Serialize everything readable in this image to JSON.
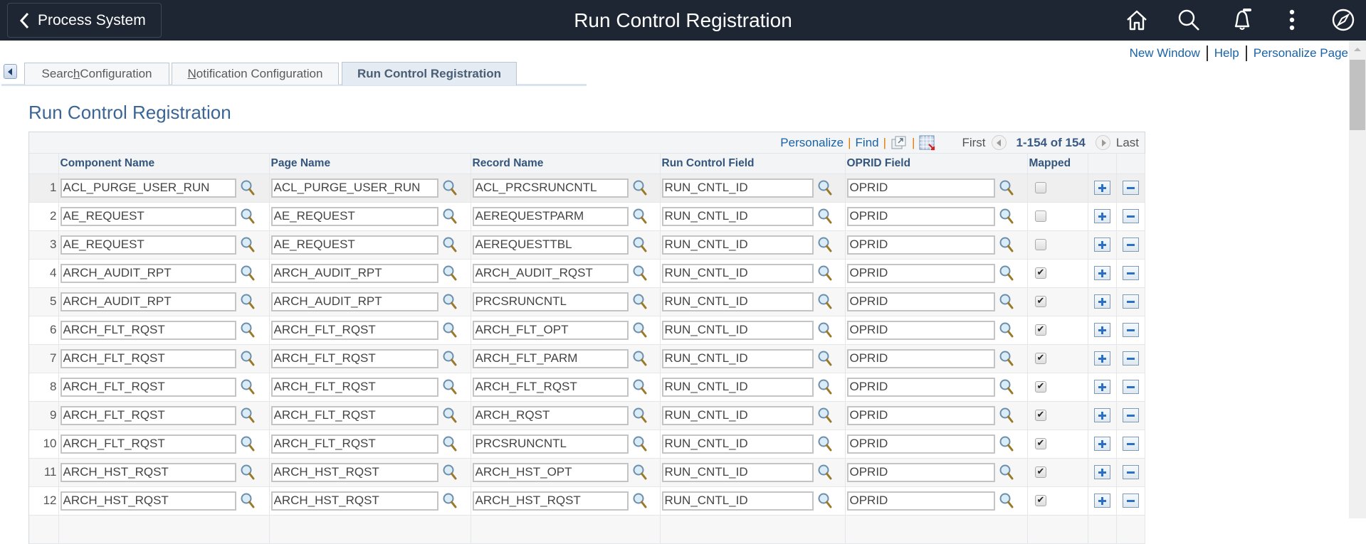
{
  "header": {
    "back_label": "Process System",
    "title": "Run Control Registration",
    "icons": [
      "home-icon",
      "search-icon",
      "notification-bell-icon",
      "actions-menu-icon",
      "navbar-compass-icon"
    ]
  },
  "toplinks": {
    "new_window": "New Window",
    "help": "Help",
    "personalize_page": "Personalize Page"
  },
  "tabs": [
    {
      "pre": "Searc",
      "accel": "h",
      "post": " Configuration",
      "active": false
    },
    {
      "pre": "",
      "accel": "N",
      "post": "otification Configuration",
      "active": false
    },
    {
      "pre": "Run Control Registration",
      "accel": "",
      "post": "",
      "active": true
    }
  ],
  "page_title": "Run Control Registration",
  "grid": {
    "toolbar": {
      "personalize": "Personalize",
      "find": "Find",
      "first": "First",
      "count": "1-154 of 154",
      "last": "Last"
    },
    "columns": [
      "Component Name",
      "Page Name",
      "Record Name",
      "Run Control Field",
      "OPRID Field",
      "Mapped"
    ],
    "rows": [
      {
        "n": "1",
        "component": "ACL_PURGE_USER_RUN",
        "page": "ACL_PURGE_USER_RUN",
        "record": "ACL_PRCSRUNCNTL",
        "runctl": "RUN_CNTL_ID",
        "oprid": "OPRID",
        "mapped": false
      },
      {
        "n": "2",
        "component": "AE_REQUEST",
        "page": "AE_REQUEST",
        "record": "AEREQUESTPARM",
        "runctl": "RUN_CNTL_ID",
        "oprid": "OPRID",
        "mapped": false
      },
      {
        "n": "3",
        "component": "AE_REQUEST",
        "page": "AE_REQUEST",
        "record": "AEREQUESTTBL",
        "runctl": "RUN_CNTL_ID",
        "oprid": "OPRID",
        "mapped": false
      },
      {
        "n": "4",
        "component": "ARCH_AUDIT_RPT",
        "page": "ARCH_AUDIT_RPT",
        "record": "ARCH_AUDIT_RQST",
        "runctl": "RUN_CNTL_ID",
        "oprid": "OPRID",
        "mapped": true
      },
      {
        "n": "5",
        "component": "ARCH_AUDIT_RPT",
        "page": "ARCH_AUDIT_RPT",
        "record": "PRCSRUNCNTL",
        "runctl": "RUN_CNTL_ID",
        "oprid": "OPRID",
        "mapped": true
      },
      {
        "n": "6",
        "component": "ARCH_FLT_RQST",
        "page": "ARCH_FLT_RQST",
        "record": "ARCH_FLT_OPT",
        "runctl": "RUN_CNTL_ID",
        "oprid": "OPRID",
        "mapped": true
      },
      {
        "n": "7",
        "component": "ARCH_FLT_RQST",
        "page": "ARCH_FLT_RQST",
        "record": "ARCH_FLT_PARM",
        "runctl": "RUN_CNTL_ID",
        "oprid": "OPRID",
        "mapped": true
      },
      {
        "n": "8",
        "component": "ARCH_FLT_RQST",
        "page": "ARCH_FLT_RQST",
        "record": "ARCH_FLT_RQST",
        "runctl": "RUN_CNTL_ID",
        "oprid": "OPRID",
        "mapped": true
      },
      {
        "n": "9",
        "component": "ARCH_FLT_RQST",
        "page": "ARCH_FLT_RQST",
        "record": "ARCH_RQST",
        "runctl": "RUN_CNTL_ID",
        "oprid": "OPRID",
        "mapped": true
      },
      {
        "n": "10",
        "component": "ARCH_FLT_RQST",
        "page": "ARCH_FLT_RQST",
        "record": "PRCSRUNCNTL",
        "runctl": "RUN_CNTL_ID",
        "oprid": "OPRID",
        "mapped": true
      },
      {
        "n": "11",
        "component": "ARCH_HST_RQST",
        "page": "ARCH_HST_RQST",
        "record": "ARCH_HST_OPT",
        "runctl": "RUN_CNTL_ID",
        "oprid": "OPRID",
        "mapped": true
      },
      {
        "n": "12",
        "component": "ARCH_HST_RQST",
        "page": "ARCH_HST_RQST",
        "record": "ARCH_HST_RQST",
        "runctl": "RUN_CNTL_ID",
        "oprid": "OPRID",
        "mapped": true
      }
    ]
  },
  "colors": {
    "header_bg": "#1e2634",
    "link": "#1a63a6",
    "title": "#3a6596",
    "separator_orange": "#e07b00"
  }
}
